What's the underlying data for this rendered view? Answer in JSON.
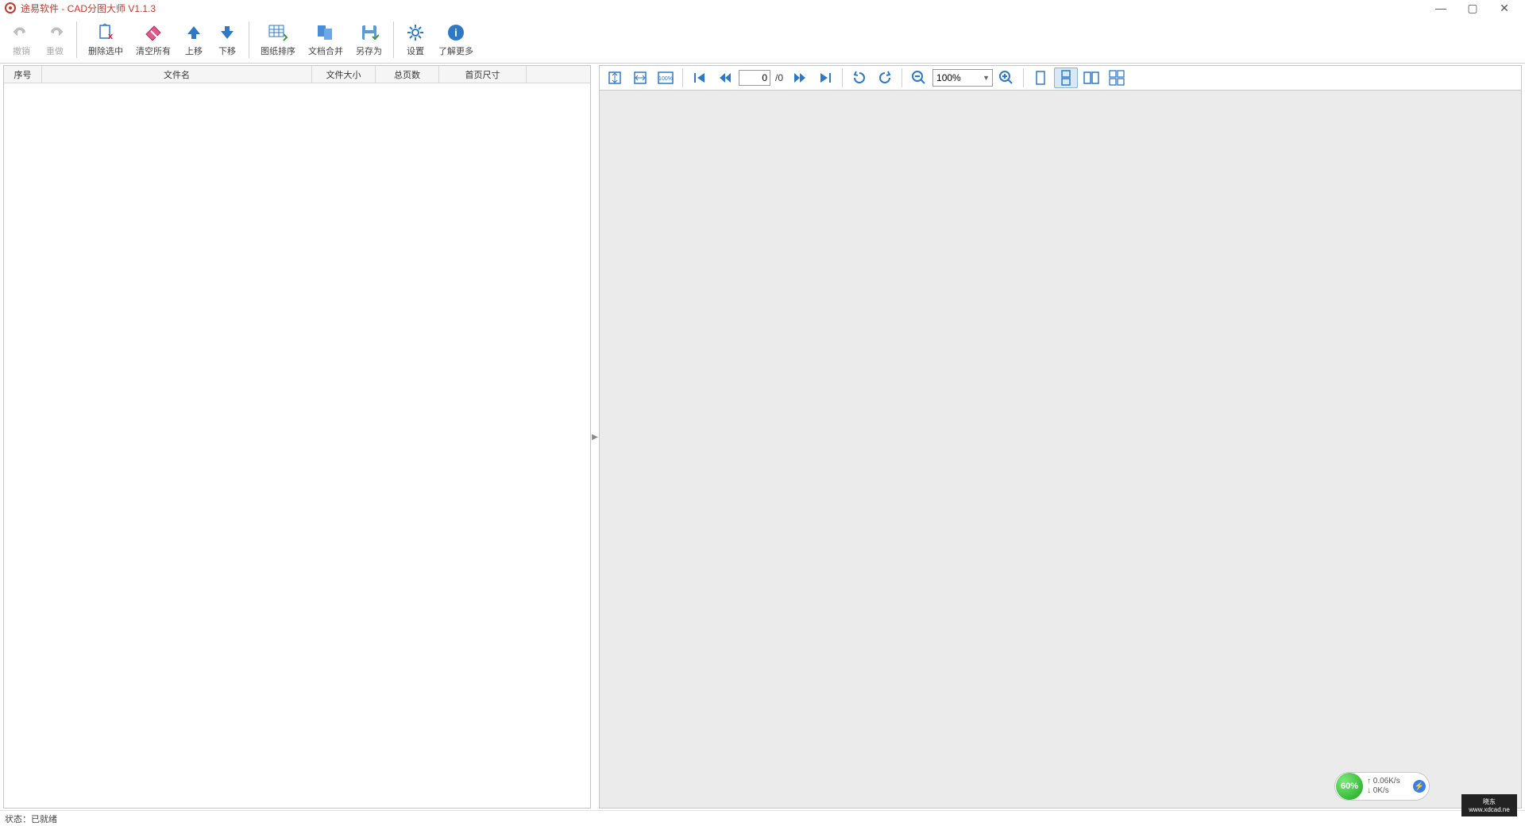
{
  "window": {
    "title": "途易软件 - CAD分图大师 V1.1.3"
  },
  "ribbon": {
    "undo": "撤销",
    "redo": "重做",
    "delete_selected": "删除选中",
    "clear_all": "清空所有",
    "move_up": "上移",
    "move_down": "下移",
    "sort_drawings": "图纸排序",
    "merge_docs": "文档合并",
    "save_as": "另存为",
    "settings": "设置",
    "learn_more": "了解更多"
  },
  "table": {
    "headers": {
      "index": "序号",
      "filename": "文件名",
      "filesize": "文件大小",
      "pages": "总页数",
      "first_page_size": "首页尺寸",
      "blank": ""
    }
  },
  "viewer": {
    "page_current": "0",
    "page_total": "/0",
    "zoom": "100%"
  },
  "status": {
    "text": "状态：已就绪"
  },
  "netfloat": {
    "percent": "60%",
    "up": "↑  0.06K/s",
    "down": "↓    0K/s"
  },
  "watermark": {
    "line1": "晓东",
    "line2": "www.xdcad.ne"
  }
}
